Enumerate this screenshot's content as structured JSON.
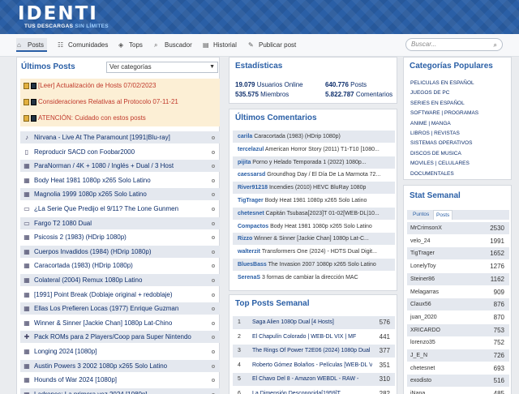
{
  "header": {
    "logo": "IDENTI",
    "tagline_a": "TUS DESCARGAS",
    "tagline_b": " SIN LÍMITES"
  },
  "nav": {
    "items": [
      {
        "label": "Posts",
        "icon": "home-icon"
      },
      {
        "label": "Comunidades",
        "icon": "community-icon"
      },
      {
        "label": "Tops",
        "icon": "layers-icon"
      },
      {
        "label": "Buscador",
        "icon": "search-icon"
      },
      {
        "label": "Historial",
        "icon": "history-icon"
      },
      {
        "label": "Publicar post",
        "icon": "edit-icon"
      }
    ],
    "search_placeholder": "Buscar..."
  },
  "last_posts": {
    "title": "Últimos Posts",
    "select": "Ver categorías",
    "announcements": [
      "[Leer] Actualización de Hosts 07/02/2023",
      "Consideraciones Relativas al Protocolo 07-11-21",
      "ATENCIÓN: Cuidado con estos posts"
    ],
    "posts": [
      {
        "title": "Nirvana - Live At The Paramount [1991|Blu-ray]",
        "icon": "guitar-icon"
      },
      {
        "title": "Reproducir SACD con Foobar2000",
        "icon": "document-icon"
      },
      {
        "title": "ParaNorman / 4K + 1080 / Inglés + Dual / 3 Host",
        "icon": "film-icon"
      },
      {
        "title": "Body Heat 1981 1080p x265 Solo Latino",
        "icon": "film-icon"
      },
      {
        "title": "Magnolia 1999 1080p x265 Solo Latino",
        "icon": "film-icon"
      },
      {
        "title": "¿La Serie Que Predijo el 9/11? The Lone Gunmen",
        "icon": "tv-icon"
      },
      {
        "title": "Fargo T2 1080 Dual",
        "icon": "tv-icon"
      },
      {
        "title": "Psicosis 2 (1983) (HDrip 1080p)",
        "icon": "film-icon"
      },
      {
        "title": "Cuerpos Invadidos (1984) (HDrip 1080p)",
        "icon": "film-icon"
      },
      {
        "title": "Caracortada (1983) (HDrip 1080p)",
        "icon": "film-icon"
      },
      {
        "title": "Colateral (2004) Remux 1080p Latino",
        "icon": "film-icon"
      },
      {
        "title": "[1991] Point Break (Doblaje original + redoblaje)",
        "icon": "film-icon"
      },
      {
        "title": "Ellas Los Prefieren Locas (1977) Enrique Guzman",
        "icon": "film-icon"
      },
      {
        "title": "Winner & Sinner [Jackie Chan] 1080p Lat-Chino",
        "icon": "film-icon"
      },
      {
        "title": "Pack ROMs para 2 Players/Coop para Super Nintendo",
        "icon": "gamepad-icon"
      },
      {
        "title": "Longing 2024 [1080p]",
        "icon": "film-icon"
      },
      {
        "title": "Austin Powers 3 2002 1080p x265 Solo Latino",
        "icon": "film-icon"
      },
      {
        "title": "Hounds of War 2024 [1080p]",
        "icon": "film-icon"
      },
      {
        "title": "Ladrones: La primera vez 2024 [1080p]",
        "icon": "film-icon"
      }
    ]
  },
  "stats": {
    "title": "Estadísticas",
    "online_value": "19.079",
    "online_label": "Usuarios Online",
    "posts_value": "640.776",
    "posts_label": "Posts",
    "members_value": "535.575",
    "members_label": "Miembros",
    "comments_value": "5.822.787",
    "comments_label": "Comentarios"
  },
  "comments": {
    "title": "Últimos Comentarios",
    "items": [
      {
        "user": "carila",
        "text": "Caracortada (1983) (HDrip 1080p)"
      },
      {
        "user": "tercelazul",
        "text": "American Horror Story (2011) T1-T10 [1080..."
      },
      {
        "user": "pijita",
        "text": "Porno y Helado Temporada 1 (2022) 1080p..."
      },
      {
        "user": "caessarsd",
        "text": "Groundhog Day / El Día De La Marmota 72..."
      },
      {
        "user": "River91218",
        "text": "Incendies (2010) HEVC BluRay 1080p"
      },
      {
        "user": "TigTrager",
        "text": "Body Heat 1981 1080p x265 Solo Latino"
      },
      {
        "user": "chetesnet",
        "text": "Capitán Tsubasa[2023]T 01-02[WEB-DL|10..."
      },
      {
        "user": "Compactos",
        "text": "Body Heat 1981 1080p x265 Solo Latino"
      },
      {
        "user": "Rizzo",
        "text": "Winner & Sinner [Jackie Chan] 1080p Lat-C..."
      },
      {
        "user": "walterzit",
        "text": "Transformers One (2024) - HDTS Dual Digit..."
      },
      {
        "user": "BluesBass",
        "text": "The Invasion 2007 1080p x265 Solo Latino"
      },
      {
        "user": "SerenaS",
        "text": "3 formas de cambiar la dirección MAC"
      }
    ]
  },
  "top_posts": {
    "title": "Top Posts Semanal",
    "items": [
      {
        "n": "1",
        "title": "Saga Alien 1080p Dual [4 Hosts]",
        "value": "576"
      },
      {
        "n": "2",
        "title": "El Chapulín Colorado | WEB-DL VIX | MF",
        "value": "441"
      },
      {
        "n": "3",
        "title": "The Rings Of Power T2E06 (2024) 1080p Dual",
        "value": "377"
      },
      {
        "n": "4",
        "title": "Roberto Gómez Bolaños - Películas [WEB-DL VIX]",
        "value": "351"
      },
      {
        "n": "5",
        "title": "El Chavo Del 8 - Amazon WEBDL - RAW -",
        "value": "310"
      },
      {
        "n": "6",
        "title": "La Dimensión Desconocida[1959]T...",
        "value": "282"
      }
    ]
  },
  "categories": {
    "title": "Categorías Populares",
    "items": [
      "PELICULAS EN ESPAÑOL",
      "JUEGOS DE PC",
      "SERIES EN ESPAÑOL",
      "SOFTWARE | PROGRAMAS",
      "ANIME | MANGA",
      "LIBROS | REVISTAS",
      "SISTEMAS OPERATIVOS",
      "DISCOS DE MUSICA",
      "MOVILES | CELULARES",
      "DOCUMENTALES"
    ]
  },
  "weekly_stats": {
    "title": "Stat Semanal",
    "tabs": [
      "Puntos",
      "Posts"
    ],
    "items": [
      {
        "user": "MrCrimsonX",
        "value": "2530"
      },
      {
        "user": "velo_24",
        "value": "1991"
      },
      {
        "user": "TigTrager",
        "value": "1652"
      },
      {
        "user": "LonelyToy",
        "value": "1276"
      },
      {
        "user": "Steiner86",
        "value": "1162"
      },
      {
        "user": "Melagarras",
        "value": "909"
      },
      {
        "user": "Claux56",
        "value": "876"
      },
      {
        "user": "juan_2020",
        "value": "870"
      },
      {
        "user": "XRICARDO",
        "value": "753"
      },
      {
        "user": "lorenzo35",
        "value": "752"
      },
      {
        "user": "J_E_N",
        "value": "726"
      },
      {
        "user": "chetesnet",
        "value": "693"
      },
      {
        "user": "exodisto",
        "value": "516"
      },
      {
        "user": "iNana",
        "value": "485"
      },
      {
        "user": "yuasa",
        "value": "450"
      }
    ]
  },
  "colors": {
    "brand": "#2a5fa6",
    "announce_bg": "#fcefd5",
    "announce_text": "#c0392b",
    "row_alt": "#e4e8ef"
  }
}
